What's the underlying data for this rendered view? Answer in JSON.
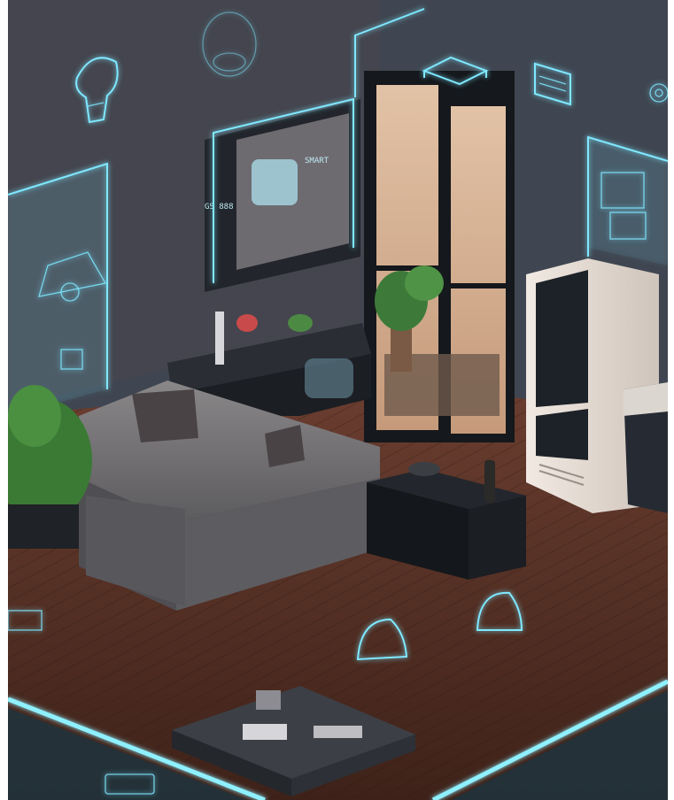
{
  "image": {
    "alt_description_hidden": "",
    "wall_labels": [
      "GS 888",
      "SMART"
    ],
    "palette": {
      "neon": "#7fe8ff",
      "wall": "#3b4450",
      "floor": "#6a3a2c",
      "sofa": "#6f6e70",
      "cabinet": "#1d2126",
      "fridge": "#e8dfd8"
    },
    "icons": [
      "light-bulb-icon",
      "thermostat-icon",
      "router-icon",
      "calendar-icon",
      "gear-icon",
      "tv-panel-icon",
      "appliance-panel-icon",
      "sensor-dome-icon"
    ]
  }
}
